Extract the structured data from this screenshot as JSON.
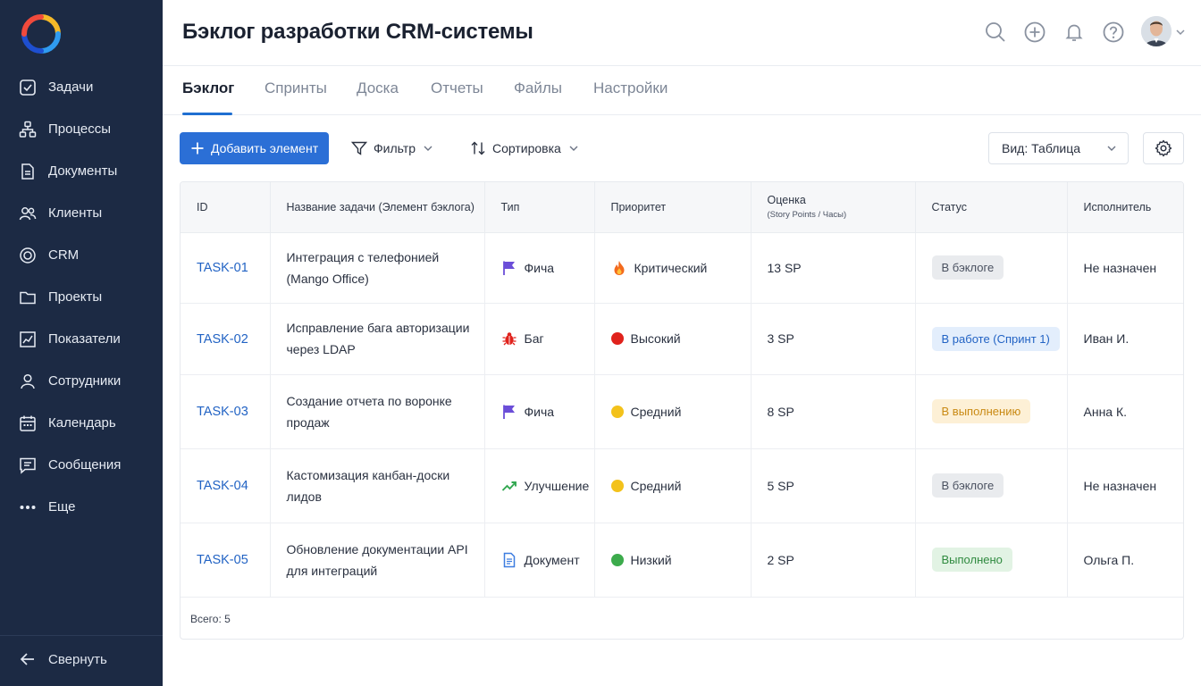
{
  "sidebar": {
    "items": [
      {
        "label": "Задачи",
        "icon": "checkbox-icon"
      },
      {
        "label": "Процессы",
        "icon": "process-icon"
      },
      {
        "label": "Документы",
        "icon": "document-icon"
      },
      {
        "label": "Клиенты",
        "icon": "clients-icon"
      },
      {
        "label": "CRM",
        "icon": "crm-icon"
      },
      {
        "label": "Проекты",
        "icon": "folder-icon"
      },
      {
        "label": "Показатели",
        "icon": "chart-icon"
      },
      {
        "label": "Сотрудники",
        "icon": "user-icon"
      },
      {
        "label": "Календарь",
        "icon": "calendar-icon"
      },
      {
        "label": "Сообщения",
        "icon": "message-icon"
      },
      {
        "label": "Еще",
        "icon": "more-dots-icon"
      }
    ],
    "collapse_label": "Свернуть"
  },
  "header": {
    "title": "Бэклог разработки CRM-системы",
    "icons": [
      "search-icon",
      "plus-circle-icon",
      "bell-icon",
      "help-icon"
    ]
  },
  "tabs": [
    {
      "label": "Бэклог",
      "active": true
    },
    {
      "label": "Спринты"
    },
    {
      "label": "Доска"
    },
    {
      "label": "Отчеты"
    },
    {
      "label": "Файлы"
    },
    {
      "label": "Настройки"
    }
  ],
  "toolbar": {
    "add_label": "Добавить элемент",
    "filter_label": "Фильтр",
    "sort_label": "Сортировка",
    "view_label": "Вид: Таблица"
  },
  "table": {
    "headers": {
      "id": "ID",
      "name": "Название задачи (Элемент бэклога)",
      "type": "Тип",
      "priority": "Приоритет",
      "estimate": "Оценка",
      "estimate_sub": "(Story Points / Часы)",
      "status": "Статус",
      "assignee": "Исполнитель"
    },
    "rows": [
      {
        "id": "TASK-01",
        "name_l1": "Интеграция с телефонией",
        "name_l2": "(Mango Office)",
        "type": "Фича",
        "type_icon": "flag-icon",
        "priority": "Критический",
        "priority_icon": "fire-icon",
        "estimate": "13 SP",
        "status": "В бэклоге",
        "assignee": "Не назначен"
      },
      {
        "id": "TASK-02",
        "name_l1": "Исправление бага авторизации",
        "name_l2": "через LDAP",
        "type": "Баг",
        "type_icon": "bug-icon",
        "priority": "Высокий",
        "priority_icon": "red-dot-icon",
        "estimate": "3 SP",
        "status": "В работе (Спринт 1)",
        "assignee": "Иван И."
      },
      {
        "id": "TASK-03",
        "name_l1": "Создание отчета по воронке",
        "name_l2": "продаж",
        "type": "Фича",
        "type_icon": "flag-icon",
        "priority": "Средний",
        "priority_icon": "yellow-dot-icon",
        "estimate": "8 SP",
        "status": "В выполнению",
        "assignee": "Анна К."
      },
      {
        "id": "TASK-04",
        "name_l1": "Кастомизация канбан-доски",
        "name_l2": "лидов",
        "type": "Улучшение",
        "type_icon": "trend-up-icon",
        "priority": "Средний",
        "priority_icon": "yellow-dot-icon",
        "estimate": "5 SP",
        "status": "В бэклоге",
        "assignee": "Не назначен"
      },
      {
        "id": "TASK-05",
        "name_l1": "Обновление документации API",
        "name_l2": "для интеграций",
        "type": "Документ",
        "type_icon": "doc-icon",
        "priority": "Низкий",
        "priority_icon": "green-dot-icon",
        "estimate": "2 SP",
        "status": "Выполнено",
        "assignee": "Ольга П."
      }
    ],
    "total": "Всего: 5"
  },
  "colors": {
    "sidebar_bg": "#1c2a44",
    "accent": "#2b6fd6",
    "link": "#2263c4",
    "status_backlog_bg": "#e9ebee",
    "status_inwork_bg": "#e3eefc",
    "status_progress_bg": "#fdf0d6",
    "status_done_bg": "#e2f3e4",
    "priority_high": "#e0221c",
    "priority_medium": "#f3c21b",
    "priority_low": "#3cab4c",
    "type_flag": "#6b4ed8"
  }
}
